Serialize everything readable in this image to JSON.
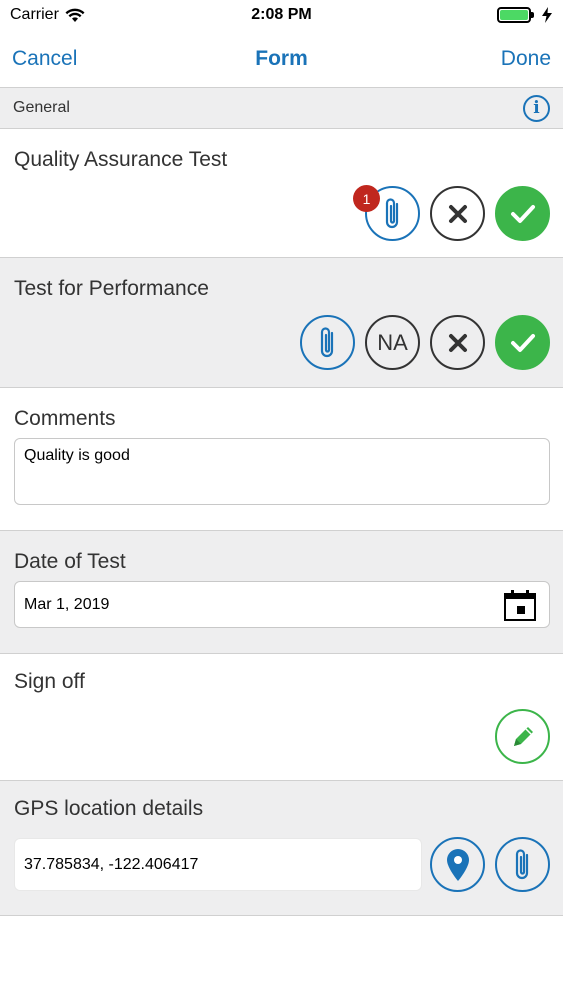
{
  "status_bar": {
    "carrier": "Carrier",
    "time": "2:08 PM"
  },
  "nav": {
    "cancel_label": "Cancel",
    "title": "Form",
    "done_label": "Done"
  },
  "section": {
    "title": "General",
    "info_icon": "info-icon"
  },
  "fields": {
    "quality": {
      "label": "Quality Assurance Test",
      "attachment_count": "1"
    },
    "performance": {
      "label": "Test for Performance",
      "na_label": "NA"
    },
    "comments": {
      "label": "Comments",
      "value": "Quality is good"
    },
    "date": {
      "label": "Date of Test",
      "value": "Mar 1, 2019"
    },
    "signoff": {
      "label": "Sign off"
    },
    "gps": {
      "label": "GPS location details",
      "value": "37.785834, -122.406417"
    }
  },
  "colors": {
    "accent": "#1a73b8",
    "success": "#3cb54a",
    "badge": "#c0271e",
    "alt_row": "#eeeeef"
  }
}
